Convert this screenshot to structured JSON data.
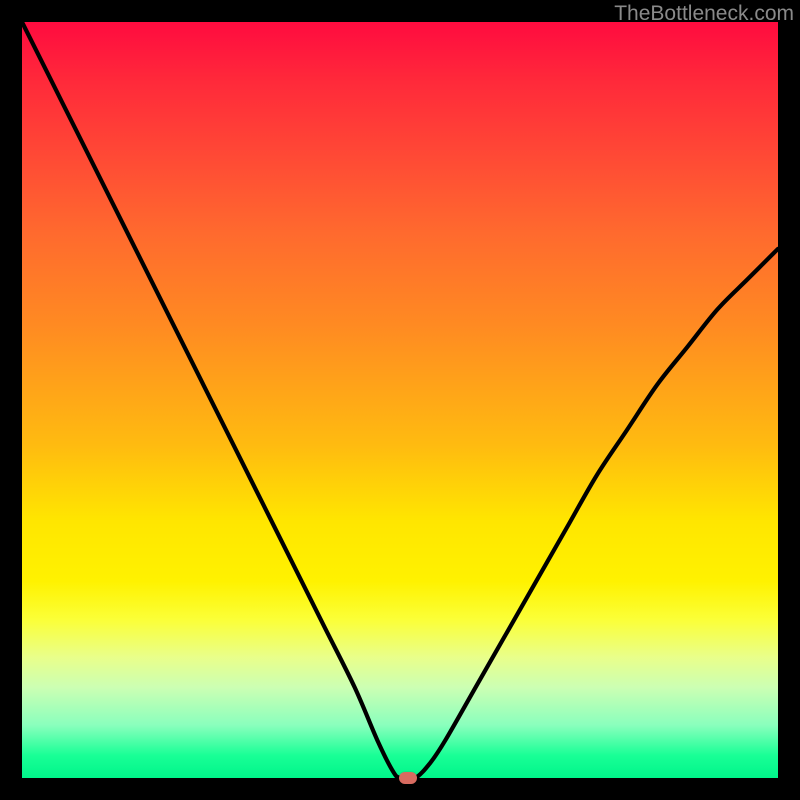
{
  "attribution": "TheBottleneck.com",
  "colors": {
    "background": "#000000",
    "curve": "#000000",
    "marker": "#d86b60"
  },
  "chart_data": {
    "type": "line",
    "title": "",
    "xlabel": "",
    "ylabel": "",
    "xlim": [
      0,
      100
    ],
    "ylim": [
      0,
      100
    ],
    "grid": false,
    "legend": false,
    "series": [
      {
        "name": "bottleneck-curve",
        "x": [
          0,
          4,
          8,
          12,
          16,
          20,
          24,
          28,
          32,
          36,
          40,
          44,
          47,
          49,
          50,
          52,
          54,
          56,
          60,
          64,
          68,
          72,
          76,
          80,
          84,
          88,
          92,
          96,
          100
        ],
        "values": [
          100,
          92,
          84,
          76,
          68,
          60,
          52,
          44,
          36,
          28,
          20,
          12,
          5,
          1,
          0,
          0,
          2,
          5,
          12,
          19,
          26,
          33,
          40,
          46,
          52,
          57,
          62,
          66,
          70
        ]
      }
    ],
    "marker": {
      "x": 51,
      "y": 0
    },
    "gradient_stops": [
      {
        "pos": 0,
        "color": "#ff0b3f"
      },
      {
        "pos": 18,
        "color": "#ff4a35"
      },
      {
        "pos": 40,
        "color": "#ff8a22"
      },
      {
        "pos": 66,
        "color": "#ffe600"
      },
      {
        "pos": 84,
        "color": "#e9ff8a"
      },
      {
        "pos": 97,
        "color": "#19ff96"
      },
      {
        "pos": 100,
        "color": "#00f58a"
      }
    ]
  }
}
